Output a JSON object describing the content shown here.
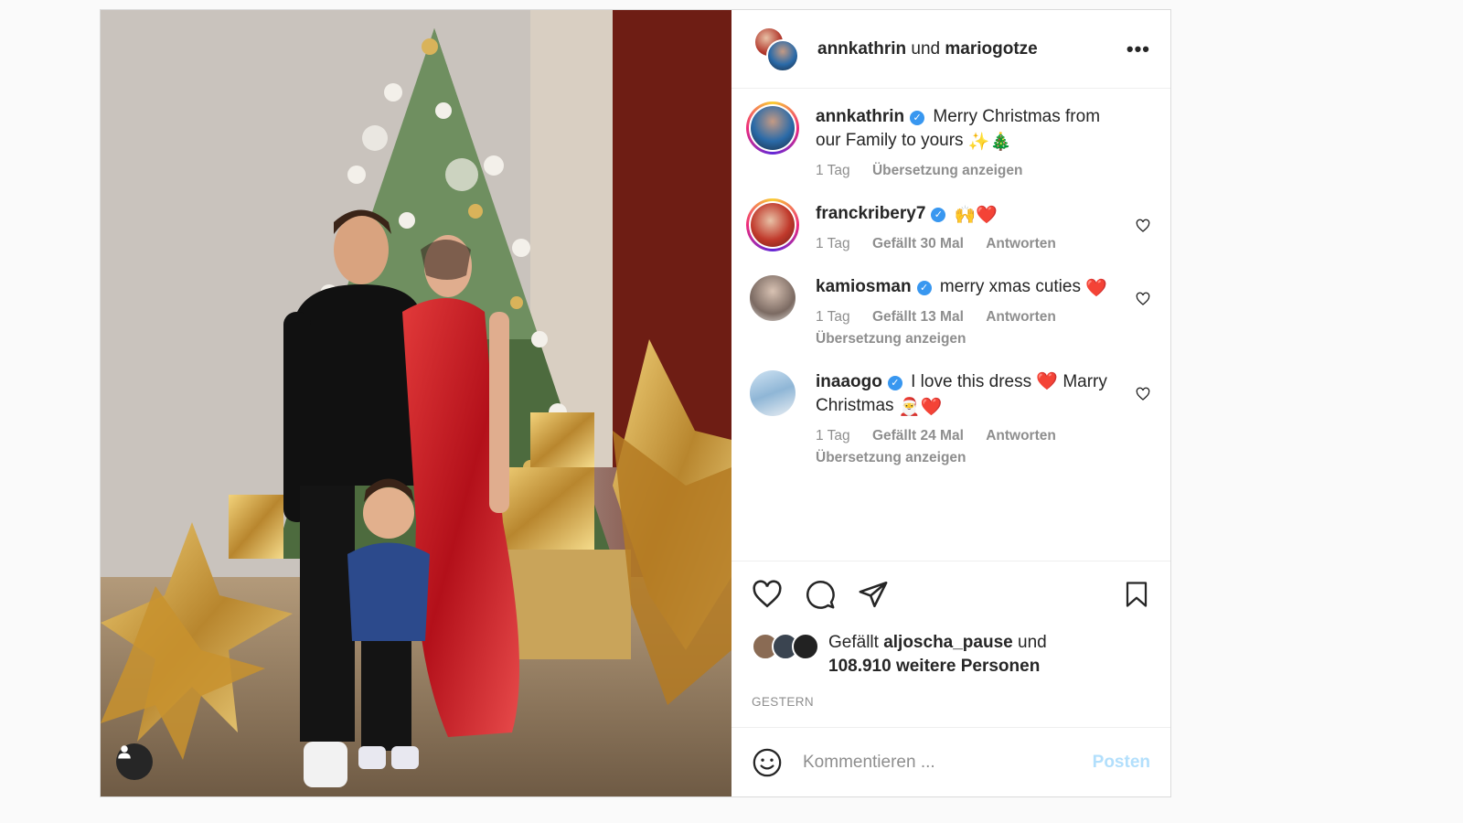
{
  "header": {
    "user1": "annkathrin",
    "joiner": "und",
    "user2": "mariogotze",
    "more_icon": "more-horizontal-icon"
  },
  "caption": {
    "user": "annkathrin",
    "text": "Merry Christmas from our Family to yours",
    "emoji": "✨🎄",
    "time": "1 Tag",
    "translate": "Übersetzung anzeigen"
  },
  "comments": [
    {
      "user": "franckribery7",
      "text": "",
      "emoji": "🙌❤️",
      "time": "1 Tag",
      "likes": "Gefällt 30 Mal",
      "reply": "Antworten",
      "translate": ""
    },
    {
      "user": "kamiosman",
      "text": "merry xmas cuties",
      "emoji": "❤️",
      "time": "1 Tag",
      "likes": "Gefällt 13 Mal",
      "reply": "Antworten",
      "translate": "Übersetzung anzeigen"
    },
    {
      "user": "inaaogo",
      "text": "I love this dress ❤️ Marry Christmas",
      "emoji": "🎅❤️",
      "time": "1 Tag",
      "likes": "Gefällt 24 Mal",
      "reply": "Antworten",
      "translate": "Übersetzung anzeigen"
    }
  ],
  "likes": {
    "prefix": "Gefällt",
    "user": "aljoscha_pause",
    "joiner": "und",
    "others": "108.910 weitere Personen"
  },
  "date": "GESTERN",
  "composer": {
    "placeholder": "Kommentieren ...",
    "post_label": "Posten"
  },
  "colors": {
    "verified": "#3897f0",
    "post_button": "#b2dffc",
    "meta_text": "#8e8e8e"
  }
}
